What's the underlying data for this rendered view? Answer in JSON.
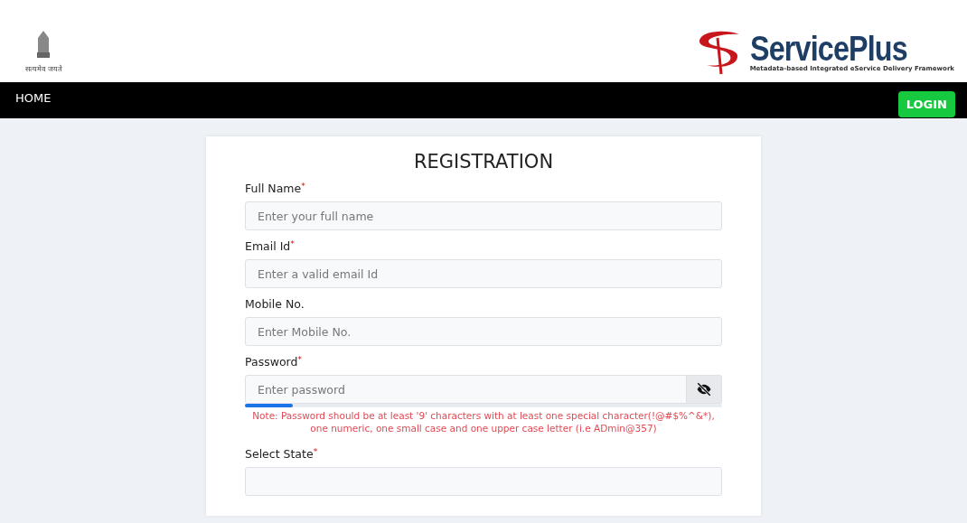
{
  "header": {
    "emblem_motto": "सत्यमेव जयते",
    "brand": "ServicePlus",
    "tagline": "Metadata-based Integrated eService Delivery Framework"
  },
  "nav": {
    "items": [
      "HOME"
    ],
    "login": "LOGIN"
  },
  "form": {
    "title": "REGISTRATION",
    "fields": [
      {
        "kind": "text",
        "label": "Full Name",
        "required_mark": "*",
        "placeholder": "Enter your full name"
      },
      {
        "kind": "text",
        "label": "Email Id",
        "required_mark": "*",
        "placeholder": "Enter a valid email Id"
      },
      {
        "kind": "text",
        "label": "Mobile No.",
        "placeholder": "Enter Mobile No."
      },
      {
        "kind": "password",
        "label": "Password",
        "required_mark": "*",
        "placeholder": "Enter password",
        "level": 0.1,
        "note": "Note: Password should be at least '9' characters with at least one special character(!@#$%^&*), one numeric, one small case and one upper case letter (i.e ADmin@357)"
      },
      {
        "kind": "select",
        "label": "Select State",
        "required_mark": "*"
      }
    ]
  }
}
